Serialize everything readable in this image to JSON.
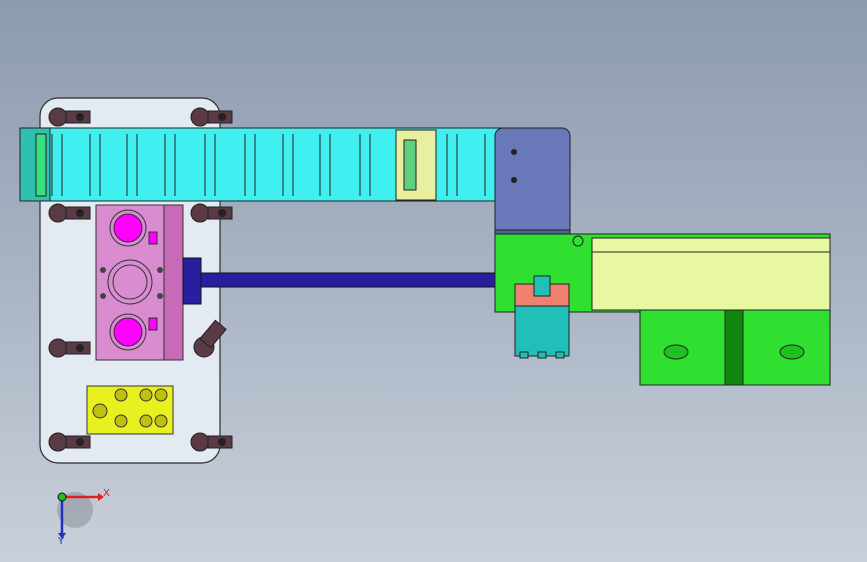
{
  "viewport": {
    "background_top": "#8d9bb0",
    "background_bottom": "#c9d0da"
  },
  "triad": {
    "x_label": "X",
    "y_label": "Y",
    "x_color": "#e02020",
    "y_color": "#2030c0",
    "origin_color": "#20c020"
  },
  "colors": {
    "base_plate": "#e3eaf1",
    "cable_chain": "#40f0f0",
    "cable_chain_accent": "#e8f0a0",
    "valve_block": "#d27ec8",
    "port_magenta": "#ff00ff",
    "manifold": "#e8f020",
    "rod": "#2a1ea0",
    "bracket": "#6878b8",
    "slide_rail": "#e8f8a0",
    "base_green": "#30e030",
    "dark_green": "#108810",
    "cylinder_teal": "#20c0b8",
    "screw_dark": "#5a3a44"
  }
}
